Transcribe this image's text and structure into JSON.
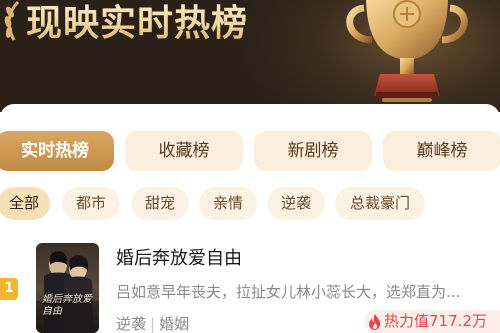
{
  "banner": {
    "title": "现映实时热榜"
  },
  "tabs": [
    {
      "label": "实时热榜",
      "active": true
    },
    {
      "label": "收藏榜",
      "active": false
    },
    {
      "label": "新剧榜",
      "active": false
    },
    {
      "label": "巅峰榜",
      "active": false
    }
  ],
  "filters": [
    {
      "label": "全部",
      "active": true
    },
    {
      "label": "都市",
      "active": false
    },
    {
      "label": "甜宠",
      "active": false
    },
    {
      "label": "亲情",
      "active": false
    },
    {
      "label": "逆袭",
      "active": false
    },
    {
      "label": "总裁豪门",
      "active": false
    }
  ],
  "list": [
    {
      "rank": "1",
      "title": "婚后奔放爱自由",
      "description": "吕如意早年丧夫，拉扯女儿林小蕊长大，选郑直为...",
      "tags": [
        "逆袭",
        "婚姻"
      ],
      "heat": "热力值717.2万",
      "poster_text": "婚后奔放爱自由"
    }
  ],
  "colors": {
    "accent_gold": "#c08a45",
    "tab_bg": "#fbeedc",
    "heat_red": "#e8454a",
    "rank_badge": "#f4b52e"
  }
}
